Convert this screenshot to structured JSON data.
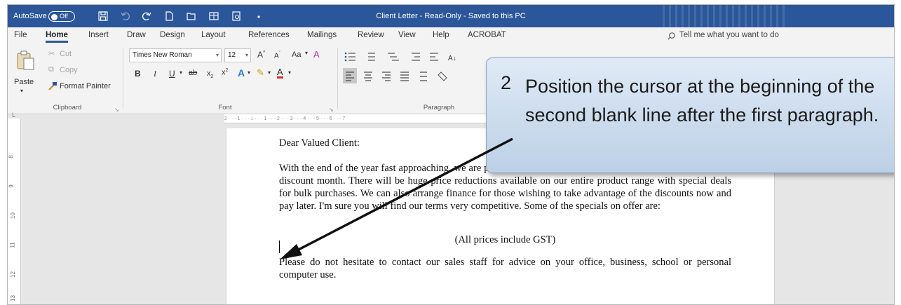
{
  "title_bar": {
    "autosave_label": "AutoSave",
    "autosave_state": "Off",
    "document_title": "Client Letter  -  Read-Only  -  Saved to this PC",
    "background_color": "#2b579a"
  },
  "menu": {
    "tabs": [
      "File",
      "Home",
      "Insert",
      "Draw",
      "Design",
      "Layout",
      "References",
      "Mailings",
      "Review",
      "View",
      "Help",
      "ACROBAT"
    ],
    "active_tab": "Home",
    "tell_me": "Tell me what you want to do"
  },
  "ribbon": {
    "clipboard": {
      "paste_label": "Paste",
      "cut_label": "Cut",
      "copy_label": "Copy",
      "format_painter_label": "Format Painter",
      "group_label": "Clipboard"
    },
    "font": {
      "font_name": "Times New Roman",
      "font_size": "12",
      "change_case_label": "Aa",
      "group_label": "Font"
    },
    "paragraph": {
      "group_label": "Paragraph"
    }
  },
  "ruler": {
    "vertical_numbers": [
      "8",
      "9",
      "10",
      "11",
      "12",
      "13"
    ],
    "horizontal_text": "2 · · · 1 · · · ⌂ · · · 1 · · · 2 · · · 3 · · · 4 · · · 5 · · · 6 · · · 7"
  },
  "letter": {
    "salutation": "Dear Valued Client:",
    "paragraph1": "With the end of the year fast approaching, we are pleased to announce that we are setting aside December as a discount month.  There will be huge price reductions available on our entire product range with special deals for bulk purchases.  We can also arrange finance for those wishing to take advantage of the discounts now and pay later.  I'm sure you will find our terms very competitive.  Some of the specials on offer are:",
    "gst_note": "(All prices include GST)",
    "paragraph2": "Please do not hesitate to contact our sales staff for advice on your office, business, school or personal computer use."
  },
  "callout": {
    "step_number": "2",
    "text": "Position the cursor at the beginning of the second blank line after the first paragraph."
  }
}
